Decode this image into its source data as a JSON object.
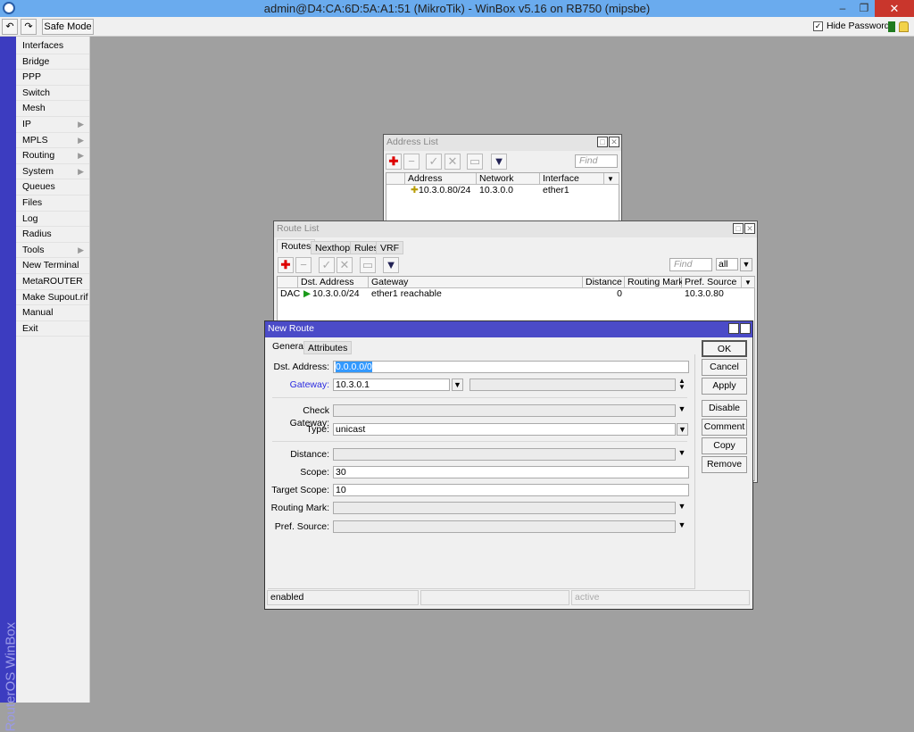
{
  "titlebar": {
    "title": "admin@D4:CA:6D:5A:A1:51 (MikroTik) - WinBox v5.16 on RB750 (mipsbe)",
    "minimize": "–",
    "restore": "❐",
    "close": "✕"
  },
  "toolbar": {
    "undo": "↶",
    "redo": "↷",
    "safe_mode": "Safe Mode",
    "hide_passwords": "Hide Passwords",
    "hide_passwords_checked": true
  },
  "sidebar": {
    "brand": "RouterOS WinBox",
    "items": [
      {
        "label": "Interfaces"
      },
      {
        "label": "Bridge"
      },
      {
        "label": "PPP"
      },
      {
        "label": "Switch"
      },
      {
        "label": "Mesh"
      },
      {
        "label": "IP",
        "submenu": true
      },
      {
        "label": "MPLS",
        "submenu": true
      },
      {
        "label": "Routing",
        "submenu": true
      },
      {
        "label": "System",
        "submenu": true
      },
      {
        "label": "Queues"
      },
      {
        "label": "Files"
      },
      {
        "label": "Log"
      },
      {
        "label": "Radius"
      },
      {
        "label": "Tools",
        "submenu": true
      },
      {
        "label": "New Terminal"
      },
      {
        "label": "MetaROUTER"
      },
      {
        "label": "Make Supout.rif"
      },
      {
        "label": "Manual"
      },
      {
        "label": "Exit"
      }
    ]
  },
  "address_list": {
    "title": "Address List",
    "find_placeholder": "Find",
    "columns": [
      "Address",
      "Network",
      "Interface"
    ],
    "rows": [
      {
        "address": "10.3.0.80/24",
        "network": "10.3.0.0",
        "interface": "ether1"
      }
    ]
  },
  "route_list": {
    "title": "Route List",
    "tabs": [
      "Routes",
      "Nexthops",
      "Rules",
      "VRF"
    ],
    "find_placeholder": "Find",
    "filter": "all",
    "columns": [
      "Dst. Address",
      "Gateway",
      "Distance",
      "Routing Mark",
      "Pref. Source"
    ],
    "rows": [
      {
        "flags": "DAC",
        "dst": "10.3.0.0/24",
        "gateway": "ether1 reachable",
        "distance": "0",
        "routing_mark": "",
        "pref_source": "10.3.0.80"
      }
    ]
  },
  "new_route": {
    "title": "New Route",
    "tabs": [
      "General",
      "Attributes"
    ],
    "fields": {
      "dst_address": {
        "label": "Dst. Address:",
        "value": "0.0.0.0/0"
      },
      "gateway": {
        "label": "Gateway:",
        "value": "10.3.0.1"
      },
      "check_gateway": {
        "label": "Check Gateway:",
        "value": ""
      },
      "type": {
        "label": "Type:",
        "value": "unicast"
      },
      "distance": {
        "label": "Distance:",
        "value": ""
      },
      "scope": {
        "label": "Scope:",
        "value": "30"
      },
      "target_scope": {
        "label": "Target Scope:",
        "value": "10"
      },
      "routing_mark": {
        "label": "Routing Mark:",
        "value": ""
      },
      "pref_source": {
        "label": "Pref. Source:",
        "value": ""
      }
    },
    "buttons": {
      "ok": "OK",
      "cancel": "Cancel",
      "apply": "Apply",
      "disable": "Disable",
      "comment": "Comment",
      "copy": "Copy",
      "remove": "Remove"
    },
    "status": {
      "left": "enabled",
      "middle": "",
      "right": "active"
    }
  },
  "colors": {
    "titlebar": "#6aabee",
    "dialog_title": "#4b4bc8",
    "sidebar_strip": "#3c3cc0",
    "desktop": "#a0a0a0",
    "close": "#c9362c",
    "gateway_label": "#2a2ae0"
  }
}
